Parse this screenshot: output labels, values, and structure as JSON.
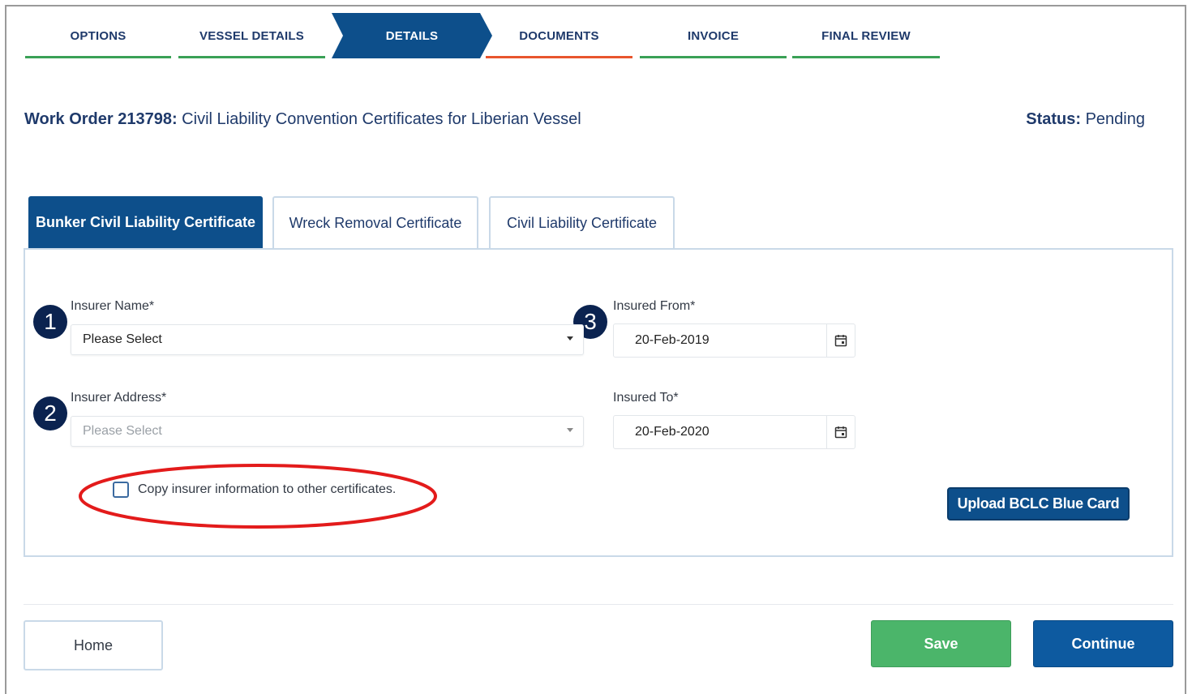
{
  "stepper": {
    "steps": [
      {
        "label": "OPTIONS",
        "state": "complete",
        "bar_color": "#3aa156"
      },
      {
        "label": "VESSEL DETAILS",
        "state": "complete",
        "bar_color": "#3aa156"
      },
      {
        "label": "DETAILS",
        "state": "active",
        "bar_color": "#0d4f8b"
      },
      {
        "label": "DOCUMENTS",
        "state": "error",
        "bar_color": "#e8552d"
      },
      {
        "label": "INVOICE",
        "state": "complete",
        "bar_color": "#3aa156"
      },
      {
        "label": "FINAL REVIEW",
        "state": "complete",
        "bar_color": "#3aa156"
      }
    ]
  },
  "header": {
    "work_order_label": "Work Order 213798:",
    "work_order_title": " Civil Liability Convention Certificates for Liberian Vessel",
    "status_label": "Status:",
    "status_value": " Pending"
  },
  "tabs": [
    {
      "label": "Bunker Civil Liability Certificate",
      "active": true
    },
    {
      "label": "Wreck Removal Certificate",
      "active": false
    },
    {
      "label": "Civil Liability Certificate",
      "active": false
    }
  ],
  "form": {
    "insurer_name": {
      "label": "Insurer Name*",
      "value": "Please Select",
      "badge": "1"
    },
    "insurer_address": {
      "label": "Insurer Address*",
      "value": "Please Select",
      "badge": "2",
      "disabled": true
    },
    "insured_from": {
      "label": "Insured From*",
      "value": "20-Feb-2019",
      "badge": "3"
    },
    "insured_to": {
      "label": "Insured To*",
      "value": "20-Feb-2020"
    },
    "copy_checkbox": {
      "label": "Copy insurer information to other certificates.",
      "checked": false
    },
    "upload_button": "Upload BCLC Blue Card"
  },
  "footer": {
    "home": "Home",
    "save": "Save",
    "continue": "Continue"
  },
  "colors": {
    "primary": "#0d4f8b",
    "success": "#4bb56a",
    "highlight": "#e31b1b",
    "badge": "#0b2350"
  },
  "icons": [
    "calendar-icon",
    "chevron-down-icon"
  ]
}
